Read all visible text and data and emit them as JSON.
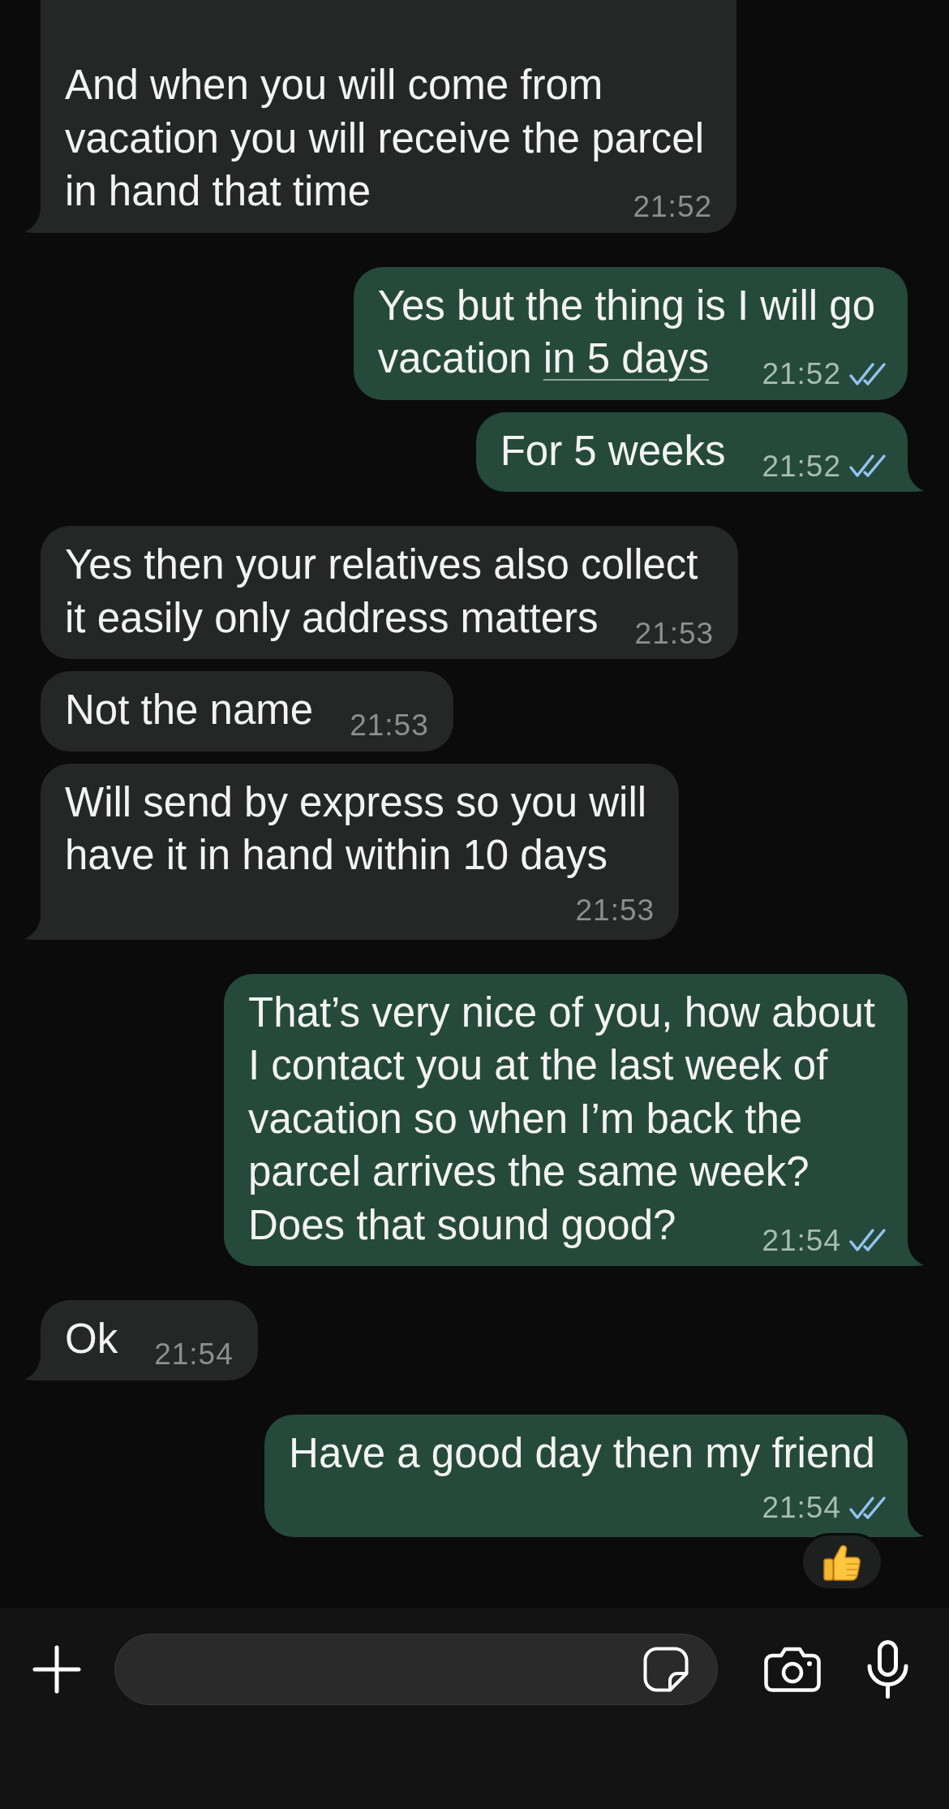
{
  "messages": [
    {
      "kind": "incoming",
      "tail": true,
      "reacted": false,
      "lines": [
        "And when you will come from",
        "vacation you will receive the parcel",
        "in hand that time"
      ],
      "time": "21:52"
    },
    {
      "kind": "outgoing",
      "tail": false,
      "reacted": false,
      "lines": [
        "Yes but the thing is I will go",
        "vacation"
      ],
      "link": "in 5 days",
      "time": "21:52",
      "read": true
    },
    {
      "kind": "outgoing",
      "tail": true,
      "reacted": false,
      "lines": [
        "For 5 weeks"
      ],
      "time": "21:52",
      "read": true
    },
    {
      "kind": "incoming",
      "tail": false,
      "reacted": false,
      "lines": [
        "Yes then your relatives also collect",
        "it easily only address matters"
      ],
      "time": "21:53"
    },
    {
      "kind": "incoming",
      "tail": false,
      "reacted": false,
      "lines": [
        "Not the name"
      ],
      "time": "21:53"
    },
    {
      "kind": "incoming",
      "tail": true,
      "reacted": false,
      "lines": [
        "Will send by express so you will",
        "have it in hand within 10 days"
      ],
      "time": "21:53"
    },
    {
      "kind": "outgoing",
      "tail": true,
      "reacted": false,
      "lines": [
        "That’s very nice of you, how about",
        "I contact you at the last week of",
        "vacation so when I’m back the",
        "parcel arrives the same week?",
        "Does that sound good?"
      ],
      "time": "21:54",
      "read": true
    },
    {
      "kind": "incoming",
      "tail": true,
      "reacted": false,
      "lines": [
        "Ok"
      ],
      "time": "21:54"
    },
    {
      "kind": "outgoing",
      "tail": true,
      "reacted": true,
      "lines": [
        "Have a good day then my friend"
      ],
      "time": "21:54",
      "read": true
    }
  ]
}
